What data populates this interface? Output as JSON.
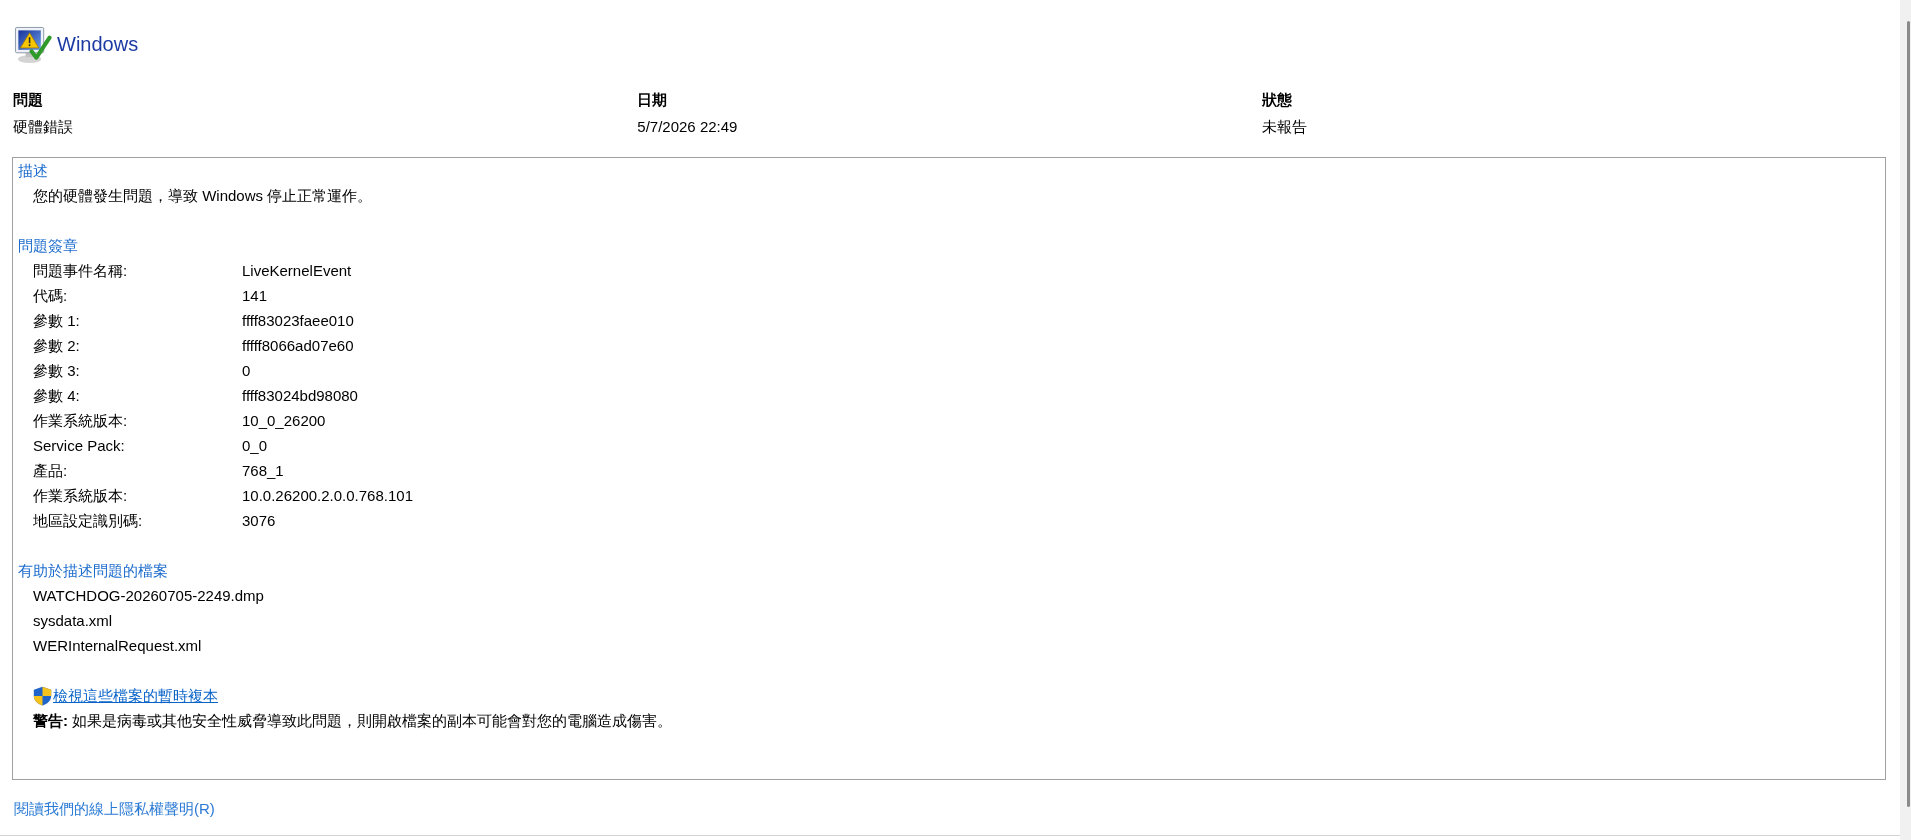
{
  "window": {
    "title": "Windows"
  },
  "summary": {
    "columns": [
      {
        "heading": "問題",
        "value": "硬體錯誤"
      },
      {
        "heading": "日期",
        "value": "5/7/2026 22:49"
      },
      {
        "heading": "狀態",
        "value": "未報告"
      }
    ]
  },
  "details": {
    "description": {
      "heading": "描述",
      "text": "您的硬體發生問題，導致 Windows 停止正常運作。"
    },
    "signature": {
      "heading": "問題簽章",
      "rows": [
        {
          "label": "問題事件名稱:",
          "value": "LiveKernelEvent"
        },
        {
          "label": "代碼:",
          "value": "141"
        },
        {
          "label": "參數 1:",
          "value": "ffff83023faee010"
        },
        {
          "label": "參數 2:",
          "value": "fffff8066ad07e60"
        },
        {
          "label": "參數 3:",
          "value": "0"
        },
        {
          "label": "參數 4:",
          "value": "ffff83024bd98080"
        },
        {
          "label": "作業系統版本:",
          "value": "10_0_26200"
        },
        {
          "label": "Service Pack:",
          "value": "0_0"
        },
        {
          "label": "產品:",
          "value": "768_1"
        },
        {
          "label": "作業系統版本:",
          "value": "10.0.26200.2.0.0.768.101"
        },
        {
          "label": "地區設定識別碼:",
          "value": "3076"
        }
      ]
    },
    "files": {
      "heading": "有助於描述問題的檔案",
      "items": [
        "WATCHDOG-20260705-2249.dmp",
        "sysdata.xml",
        "WERInternalRequest.xml"
      ]
    },
    "view_copies_link": "檢視這些檔案的暫時複本",
    "warning": "**警告:** 如果是病毒或其他安全性威脅導致此問題，則開啟檔案的副本可能會對您的電腦造成傷害。"
  },
  "privacy_link": "閱讀我們的線上隱私權聲明(R)"
}
